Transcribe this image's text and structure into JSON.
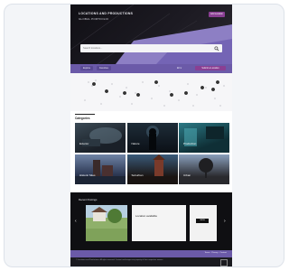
{
  "hero": {
    "title": "LOCATIONS AND PRODUCTIONS",
    "subtitle": "GLOBAL PORTFOLIO",
    "button_label": "Add Location"
  },
  "search": {
    "placeholder": "Search locations..."
  },
  "nav": {
    "items": [
      {
        "label": "Explore"
      },
      {
        "label": "Favorites"
      }
    ],
    "language": "EN ▾",
    "share_label": "Submit a Location"
  },
  "categories": {
    "title": "Categories",
    "tiles": [
      {
        "label": "Exterior"
      },
      {
        "label": "Nature"
      },
      {
        "label": "Production"
      },
      {
        "label": "Historic Sites"
      },
      {
        "label": "Suburban"
      },
      {
        "label": "Urban"
      }
    ]
  },
  "recent": {
    "title": "Recent Postings",
    "cards": [
      {
        "text": ""
      },
      {
        "text": "Location available"
      },
      {
        "pill": "VIEW"
      }
    ]
  },
  "footer": {
    "bar_text": "Terms · Privacy · Contact",
    "text": "© Locations and Productions. All rights reserved. Content and images are property of their respective owners."
  },
  "colors": {
    "accent": "#6b5aa8",
    "magenta": "#8a3f93",
    "dark": "#111015"
  }
}
